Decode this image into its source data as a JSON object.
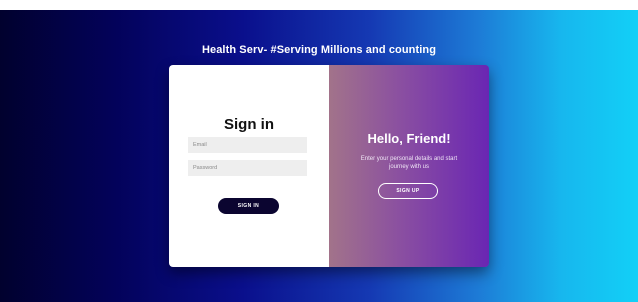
{
  "header": {
    "title": "Health Serv- #Serving Millions and counting"
  },
  "signin_panel": {
    "title": "Sign in",
    "email_placeholder": "Email",
    "password_placeholder": "Password",
    "button_label": "SIGN IN"
  },
  "welcome_panel": {
    "title": "Hello, Friend!",
    "text": "Enter your personal details and start journey with us",
    "button_label": "SIGN UP"
  },
  "colors": {
    "signin_button": "#0b0530",
    "panel_gradient_start": "#a2738a",
    "panel_gradient_end": "#6a26b3"
  }
}
